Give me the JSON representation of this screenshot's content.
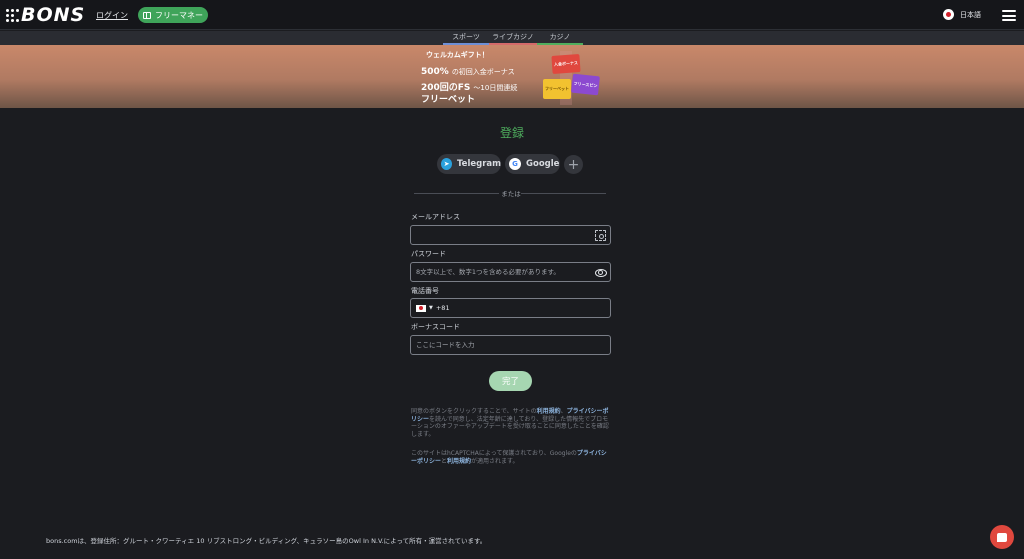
{
  "header": {
    "logo": "BONS",
    "login": "ログイン",
    "free_money": "フリーマネー",
    "language": "日本語"
  },
  "nav": {
    "tabs": [
      {
        "label": "スポーツ"
      },
      {
        "label": "ライブカジノ"
      },
      {
        "label": "カジノ"
      }
    ]
  },
  "banner": {
    "title": "ウェルカムギフト！",
    "line1_big": "500%",
    "line1_small": "の初回入金ボーナス",
    "line2_big": "200回のFS",
    "line2_small": "～10日間連続",
    "line3": "フリーベット",
    "art_labels": [
      "入金ボーナス",
      "フリーベット",
      "フリースピン"
    ]
  },
  "form": {
    "title": "登録",
    "telegram": "Telegram",
    "google": "Google",
    "or": "または",
    "email_label": "メールアドレス",
    "email_value": "",
    "password_label": "パスワード",
    "password_placeholder": "8文字以上で、数字1つを含める必要があります。",
    "phone_label": "電話番号",
    "phone_code": "+81",
    "bonus_label": "ボーナスコード",
    "bonus_placeholder": "ここにコードを入力",
    "submit": "完了"
  },
  "legal": {
    "p1_a": "同意のボタンをクリックすることで、サイトの",
    "p1_terms": "利用規約",
    "p1_b": "、",
    "p1_privacy": "プライバシーポリシー",
    "p1_c": "を読んで同意し、法定年齢に達しており、登録した情報先でプロモーションのオファーやアップデートを受け取ることに同意したことを確認します。",
    "p2_a": "このサイトはhCAPTCHAによって保護されており、Googleの",
    "p2_privacy": "プライバシーポリシー",
    "p2_b": "と",
    "p2_terms": "利用規約",
    "p2_c": "が適用されます。"
  },
  "footer": {
    "text": "bons.comは、登録住所：グルート・クワーティエ 10 リブストロング・ビルディング、キュラソー島のOwl In N.V.によって所有・運営されています。"
  },
  "colors": {
    "accent": "#4fae5e",
    "background": "#1b1c20",
    "chat": "#e0483e"
  }
}
